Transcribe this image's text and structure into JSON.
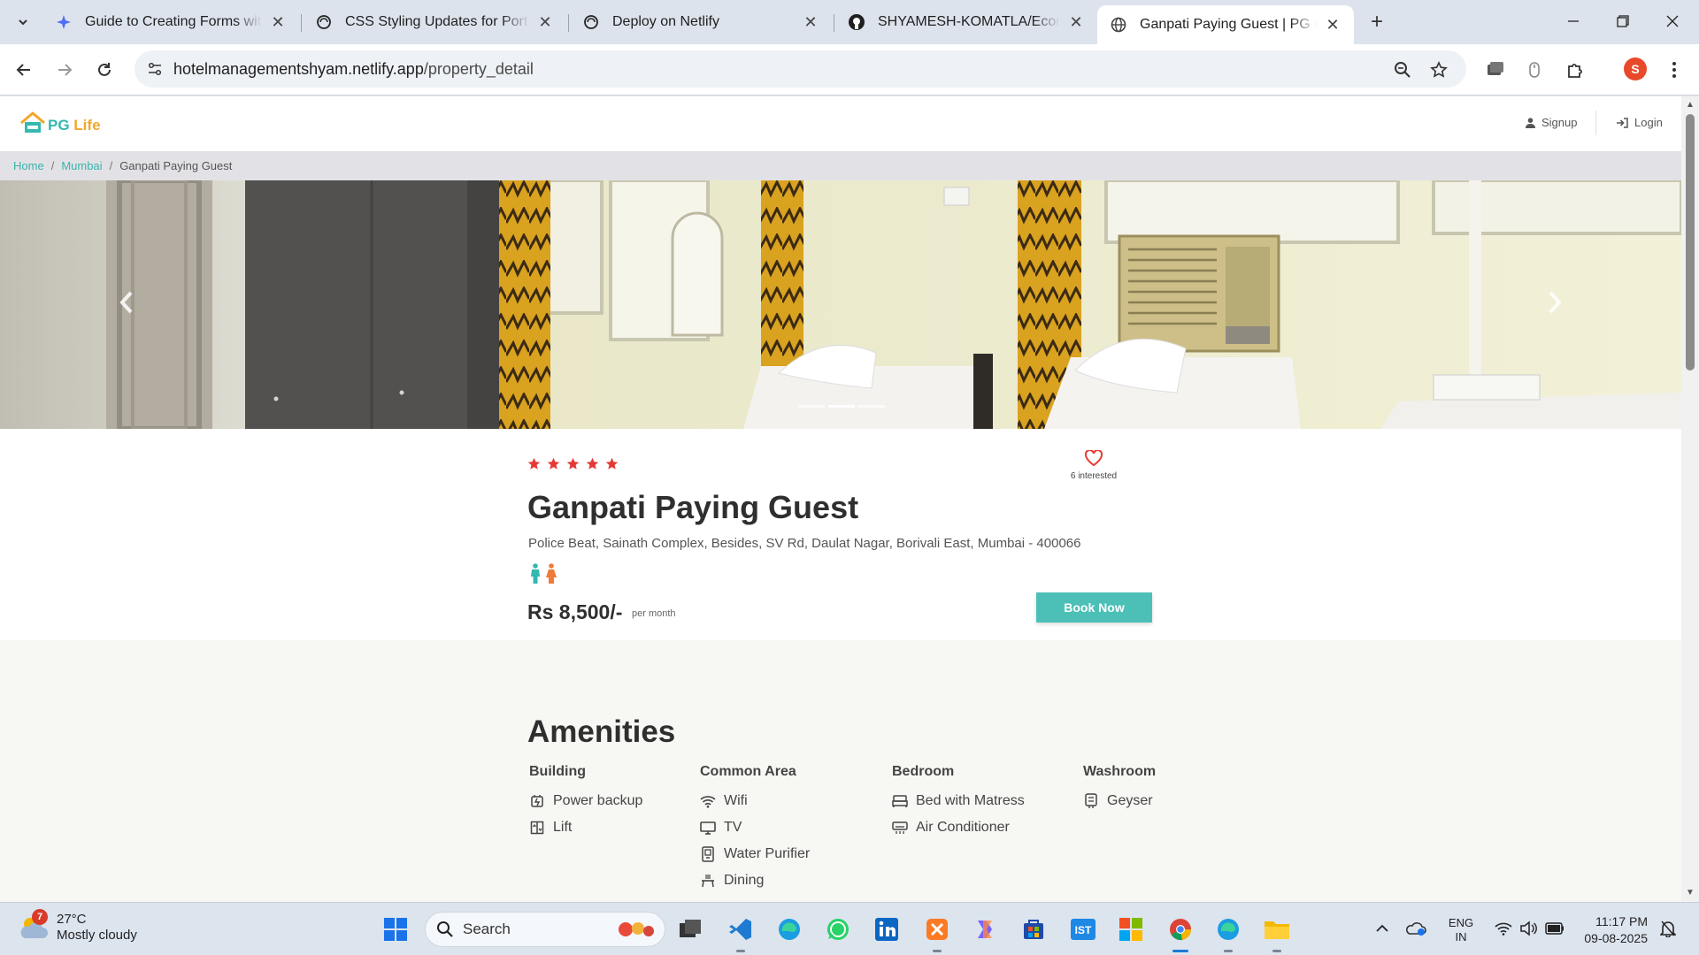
{
  "browser": {
    "tabs": [
      {
        "title": "Guide to Creating Forms with Fo",
        "icon": "sparkle-icon",
        "active": false
      },
      {
        "title": "CSS Styling Updates for Portfolio",
        "icon": "chatgpt-icon",
        "active": false
      },
      {
        "title": "Deploy on Netlify",
        "icon": "chatgpt-icon",
        "active": false
      },
      {
        "title": "SHYAMESH-KOMATLA/Ecommerce",
        "icon": "github-icon",
        "active": false
      },
      {
        "title": "Ganpati Paying Guest | PG Life",
        "icon": "globe-icon",
        "active": true
      }
    ],
    "url_host": "hotelmanagementshyam.netlify.app",
    "url_path": "/property_detail",
    "profile_initial": "S"
  },
  "site": {
    "logo_text_a": "PG",
    "logo_text_b": "Life",
    "nav": {
      "signup": "Signup",
      "login": "Login"
    },
    "breadcrumb": {
      "home": "Home",
      "city": "Mumbai",
      "current": "Ganpati Paying Guest",
      "separator": "/"
    }
  },
  "property": {
    "rating_stars": 5,
    "interested_count": "6 interested",
    "name": "Ganpati Paying Guest",
    "address": "Police Beat, Sainath Complex, Besides, SV Rd, Daulat Nagar, Borivali East, Mumbai - 400066",
    "gender": "unisex",
    "price": "Rs 8,500/-",
    "price_unit": "per month",
    "book_label": "Book Now",
    "carousel_slides": 3,
    "carousel_active": 2
  },
  "amenities": {
    "title": "Amenities",
    "groups": [
      {
        "heading": "Building",
        "items": [
          {
            "label": "Power backup",
            "icon": "power-backup-icon"
          },
          {
            "label": "Lift",
            "icon": "lift-icon"
          }
        ]
      },
      {
        "heading": "Common Area",
        "items": [
          {
            "label": "Wifi",
            "icon": "wifi-icon"
          },
          {
            "label": "TV",
            "icon": "tv-icon"
          },
          {
            "label": "Water Purifier",
            "icon": "water-purifier-icon"
          },
          {
            "label": "Dining",
            "icon": "dining-icon"
          }
        ]
      },
      {
        "heading": "Bedroom",
        "items": [
          {
            "label": "Bed with Matress",
            "icon": "bed-icon"
          },
          {
            "label": "Air Conditioner",
            "icon": "air-conditioner-icon"
          }
        ]
      },
      {
        "heading": "Washroom",
        "items": [
          {
            "label": "Geyser",
            "icon": "geyser-icon"
          }
        ]
      }
    ]
  },
  "taskbar": {
    "weather_temp": "27°C",
    "weather_desc": "Mostly cloudy",
    "weather_badge": "7",
    "search_placeholder": "Search",
    "lang_top": "ENG",
    "lang_bottom": "IN",
    "time": "11:17 PM",
    "date": "09-08-2025"
  },
  "colors": {
    "accent": "#4cc0b6",
    "star": "#e53935",
    "brand_orange": "#f2a72b"
  }
}
